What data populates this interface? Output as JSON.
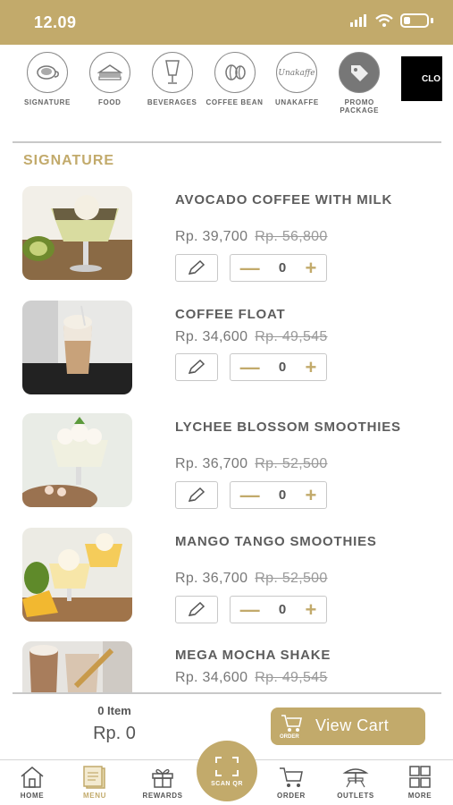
{
  "status": {
    "time": "12.09"
  },
  "categories": [
    {
      "label": "SIGNATURE",
      "icon": "coffee-cup-icon"
    },
    {
      "label": "FOOD",
      "icon": "sandwich-icon"
    },
    {
      "label": "BEVERAGES",
      "icon": "glass-icon"
    },
    {
      "label": "COFFEE BEAN",
      "icon": "coffee-bean-icon"
    },
    {
      "label": "UNAKAFFE",
      "icon": "unakaffe-logo"
    },
    {
      "label": "PROMO PACKAGE",
      "icon": "price-tag-icon"
    },
    {
      "label": "CLO",
      "icon": "cloud-logo"
    }
  ],
  "section_title": "SIGNATURE",
  "products": [
    {
      "name": "AVOCADO COFFEE WITH MILK",
      "price": "Rp. 39,700",
      "old_price": "Rp. 56,800",
      "qty": "0"
    },
    {
      "name": "COFFEE FLOAT",
      "price": "Rp. 34,600",
      "old_price": "Rp. 49,545",
      "qty": "0"
    },
    {
      "name": "LYCHEE BLOSSOM SMOOTHIES",
      "price": "Rp. 36,700",
      "old_price": "Rp. 52,500",
      "qty": "0"
    },
    {
      "name": "MANGO TANGO SMOOTHIES",
      "price": "Rp. 36,700",
      "old_price": "Rp. 52,500",
      "qty": "0"
    },
    {
      "name": "MEGA MOCHA SHAKE",
      "price": "Rp. 34,600",
      "old_price": "Rp. 49,545",
      "qty": "0"
    }
  ],
  "cart": {
    "count": "0 Item",
    "total": "Rp. 0",
    "order_label": "ORDER",
    "view_cart": "View Cart"
  },
  "nav": {
    "home": "HOME",
    "menu": "MENU",
    "rewards": "REWARDS",
    "scan": "SCAN QR",
    "order": "ORDER",
    "outlets": "OUTLETS",
    "more": "MORE"
  },
  "colors": {
    "accent": "#c2aa6b",
    "text": "#5d5d5d",
    "muted": "#9a9a9a"
  }
}
